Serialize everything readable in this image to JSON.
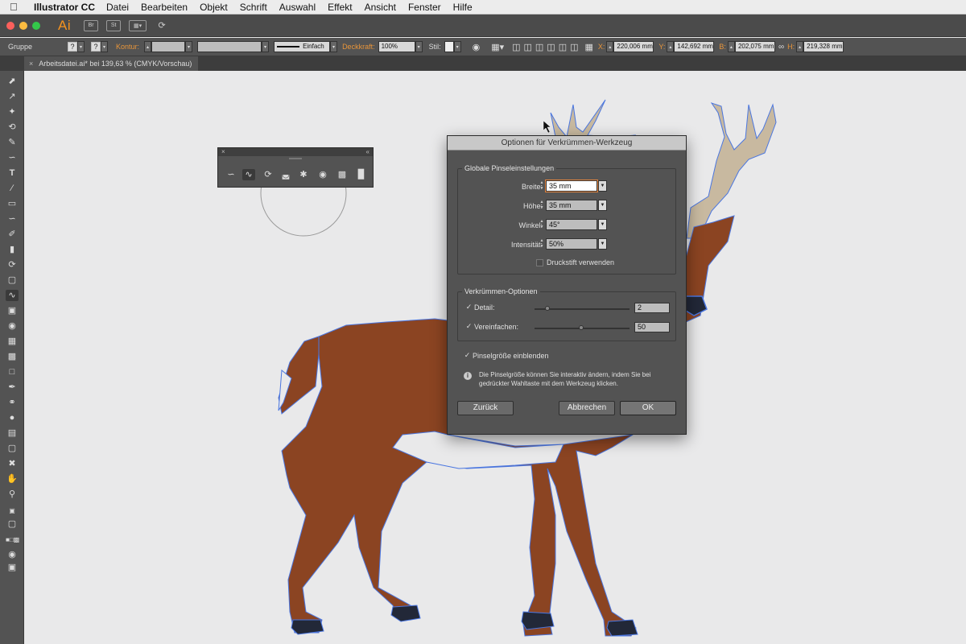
{
  "menubar": {
    "app_name": "Illustrator CC",
    "items": [
      "Datei",
      "Bearbeiten",
      "Objekt",
      "Schrift",
      "Auswahl",
      "Effekt",
      "Ansicht",
      "Fenster",
      "Hilfe"
    ]
  },
  "appbar": {
    "logo": "Ai",
    "bridge": "Br",
    "stock": "St"
  },
  "controlbar": {
    "selection_label": "Gruppe",
    "kontur_label": "Kontur:",
    "stroke_style": "Einfach",
    "deckkraft_label": "Deckkraft:",
    "deckkraft_value": "100%",
    "stil_label": "Stil:",
    "x_label": "X:",
    "x_value": "220,006 mm",
    "y_label": "Y:",
    "y_value": "142,692 mm",
    "b_label": "B:",
    "b_value": "202,075 mm",
    "h_label": "H:",
    "h_value": "219,328 mm"
  },
  "document_tab": {
    "title": "Arbeitsdatei.ai* bei 139,63 % (CMYK/Vorschau)"
  },
  "dialog": {
    "title": "Optionen für Verkrümmen-Werkzeug",
    "global_group": "Globale Pinseleinstellungen",
    "breite_label": "Breite:",
    "breite_value": "35 mm",
    "hoehe_label": "Höhe:",
    "hoehe_value": "35 mm",
    "winkel_label": "Winkel:",
    "winkel_value": "45°",
    "intensitaet_label": "Intensität:",
    "intensitaet_value": "50%",
    "druckstift_label": "Druckstift verwenden",
    "options_group": "Verkrümmen-Optionen",
    "detail_label": "Detail:",
    "detail_value": "2",
    "vereinfachen_label": "Vereinfachen:",
    "vereinfachen_value": "50",
    "pinselgroesse_label": "Pinselgröße einblenden",
    "info_text": "Die Pinselgröße können Sie interaktiv ändern, indem Sie bei gedrückter Wahltaste mit dem Werkzeug klicken.",
    "zurueck_label": "Zurück",
    "abbrechen_label": "Abbrechen",
    "ok_label": "OK"
  },
  "colors": {
    "deer_body": "#8b4422",
    "antler": "#c8b9a0",
    "hoof": "#222838",
    "selection": "#4a76e0",
    "accent": "#e8953a"
  }
}
